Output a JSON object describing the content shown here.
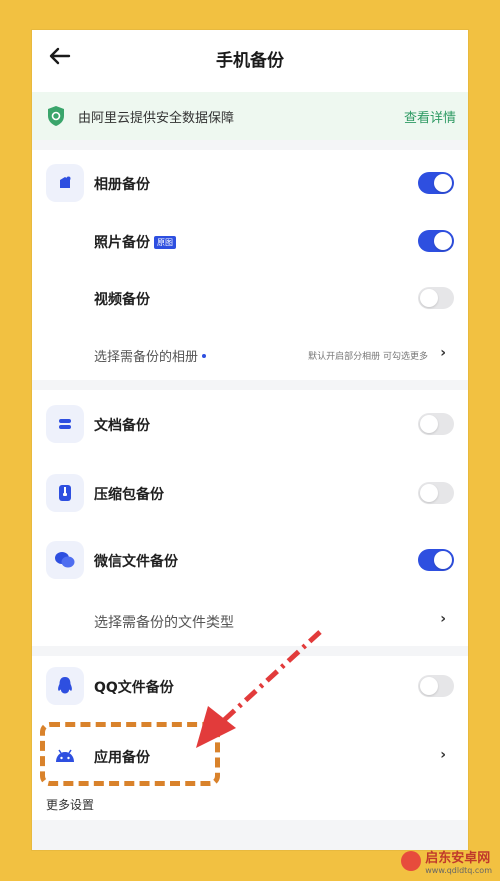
{
  "header": {
    "title": "手机备份"
  },
  "notice": {
    "text": "由阿里云提供安全数据保障",
    "link": "查看详情"
  },
  "items": {
    "album": {
      "label": "相册备份",
      "on": true
    },
    "photo": {
      "label": "照片备份",
      "badge": "原图",
      "on": true
    },
    "video": {
      "label": "视频备份",
      "on": false
    },
    "choose_album": {
      "label": "选择需备份的相册",
      "hint": "默认开启部分相册 可勾选更多"
    },
    "docs": {
      "label": "文档备份",
      "on": false
    },
    "zip": {
      "label": "压缩包备份",
      "on": false
    },
    "wechat": {
      "label": "微信文件备份",
      "on": true
    },
    "choose_types": {
      "label": "选择需备份的文件类型"
    },
    "qq": {
      "label": "QQ文件备份",
      "on": false
    },
    "apps": {
      "label": "应用备份"
    }
  },
  "more_settings": "更多设置",
  "colors": {
    "accent": "#2e4fe0",
    "annotation": "#d9822b",
    "arrow": "#e23b3b",
    "background": "#f2c141"
  },
  "watermark": {
    "name": "启东安卓网",
    "url": "www.qdldtq.com"
  }
}
